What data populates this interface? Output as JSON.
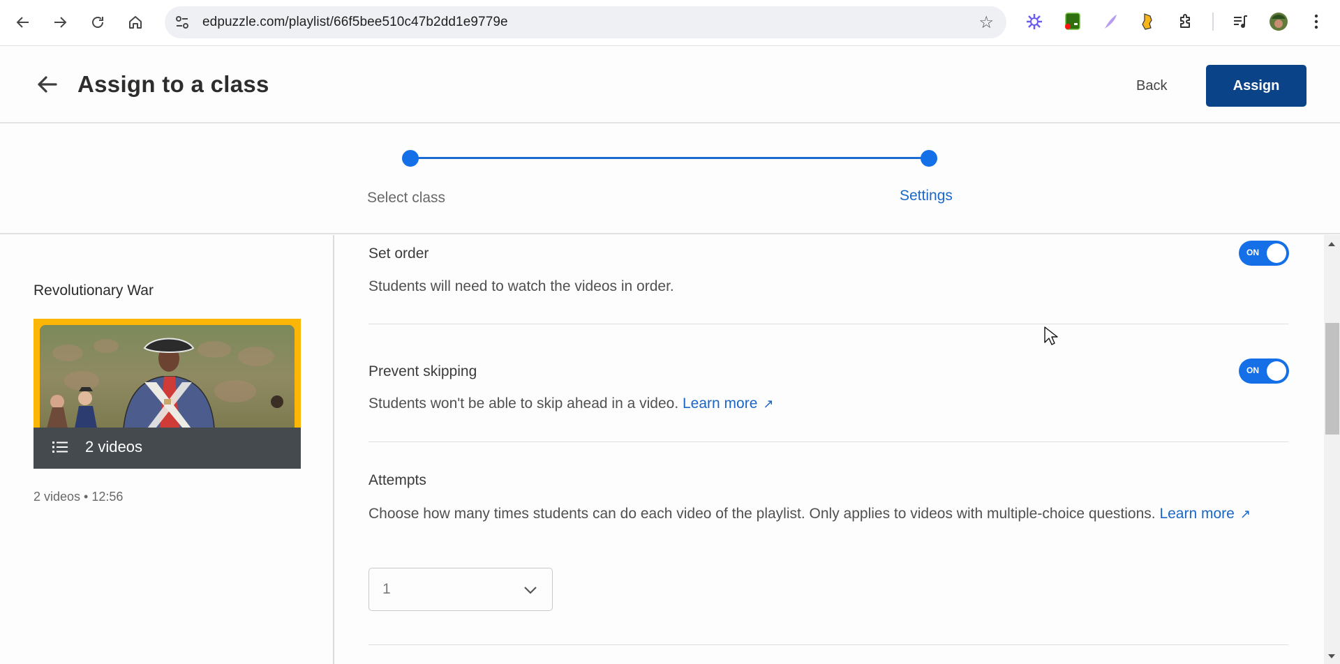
{
  "browser": {
    "url": "edpuzzle.com/playlist/66f5bee510c47b2dd1e9779e",
    "nav": [
      "back-icon",
      "forward-icon",
      "reload-icon",
      "home-icon"
    ],
    "extensions": [
      "perplexity-icon",
      "green-extension-icon",
      "feather-extension-icon",
      "honey-extension-icon",
      "extensions-puzzle-icon",
      "media-control-icon",
      "profile-avatar",
      "menu-kebab-icon"
    ]
  },
  "header": {
    "title": "Assign to a class",
    "back_label": "Back",
    "assign_label": "Assign"
  },
  "stepper": {
    "steps": [
      {
        "label": "Select class",
        "state": "complete"
      },
      {
        "label": "Settings",
        "state": "active"
      }
    ]
  },
  "playlist": {
    "title": "Revolutionary War",
    "video_count_label": "2 videos",
    "meta": "2 videos • 12:56",
    "thumb_border_color": "#fbb608"
  },
  "settings": {
    "set_order": {
      "title": "Set order",
      "description": "Students will need to watch the videos in order.",
      "toggle_label": "ON",
      "enabled": true
    },
    "prevent_skipping": {
      "title": "Prevent skipping",
      "description": "Students won't be able to skip ahead in a video.",
      "link": "Learn more",
      "toggle_label": "ON",
      "enabled": true
    },
    "attempts": {
      "title": "Attempts",
      "description": "Choose how many times students can do each video of the playlist. Only applies to videos with multiple-choice questions.",
      "link": "Learn more",
      "selected": "1"
    }
  },
  "colors": {
    "primary": "#0b4389",
    "accent": "#1570e8",
    "link": "#1a66c6"
  }
}
